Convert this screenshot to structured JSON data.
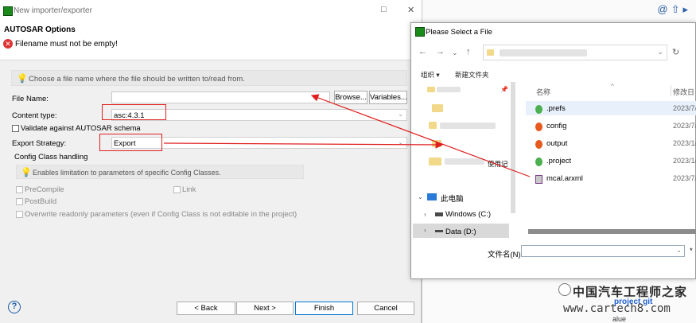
{
  "importer": {
    "window_title": "New importer/exporter",
    "header_title": "AUTOSAR Options",
    "error_message": "Filename must not be empty!",
    "hint_filename": "Choose a file name where the file should be written to/read from.",
    "file_name_label": "File Name:",
    "file_name_value": "",
    "browse_button": "Browse...",
    "variables_button": "Variables...",
    "content_type_label": "Content type:",
    "content_type_value": "asc:4.3.1",
    "validate_label": "Validate against AUTOSAR schema",
    "export_strategy_label": "Export Strategy:",
    "export_strategy_value": "Export",
    "config_group_title": "Config Class handling",
    "config_hint": "Enables limitation to parameters of specific Config Classes.",
    "precompile_label": "PreCompile",
    "link_label": "Link",
    "postbuild_label": "PostBuild",
    "overwrite_label": "Overwrite readonly parameters (even if Config Class is not editable in the project)",
    "help_glyph": "?",
    "back_button": "< Back",
    "next_button": "Next >",
    "finish_button": "Finish",
    "cancel_button": "Cancel"
  },
  "file_dialog": {
    "title": "Please Select a File",
    "organize": "组织 ▾",
    "new_folder": "新建文件夹",
    "col_name": "名称",
    "col_date": "修改日",
    "pinned_partial": "使用记",
    "this_pc": "此电脑",
    "drive_c": "Windows (C:)",
    "drive_d": "Data (D:)",
    "files": [
      {
        "name": ".prefs",
        "date": "2023/7/",
        "icon": "green-file-icon"
      },
      {
        "name": "config",
        "date": "2023/7/",
        "icon": "orange-file-icon"
      },
      {
        "name": "output",
        "date": "2023/1/",
        "icon": "orange-file-icon"
      },
      {
        "name": ".project",
        "date": "2023/1/",
        "icon": "green-file-icon"
      },
      {
        "name": "mcal.arxml",
        "date": "2023/7/",
        "icon": "arxml-file-icon"
      }
    ],
    "filename_label": "文件名(N):",
    "filename_value": "",
    "filter_partial": "*"
  },
  "background": {
    "watermark": "中国汽车工程师之家",
    "url": "www.cartech8.com",
    "project_git": "project git",
    "value_label": "alue"
  },
  "colors": {
    "annotation_red": "#e02020",
    "error_red": "#dd3333",
    "accent_blue": "#0078d7"
  }
}
